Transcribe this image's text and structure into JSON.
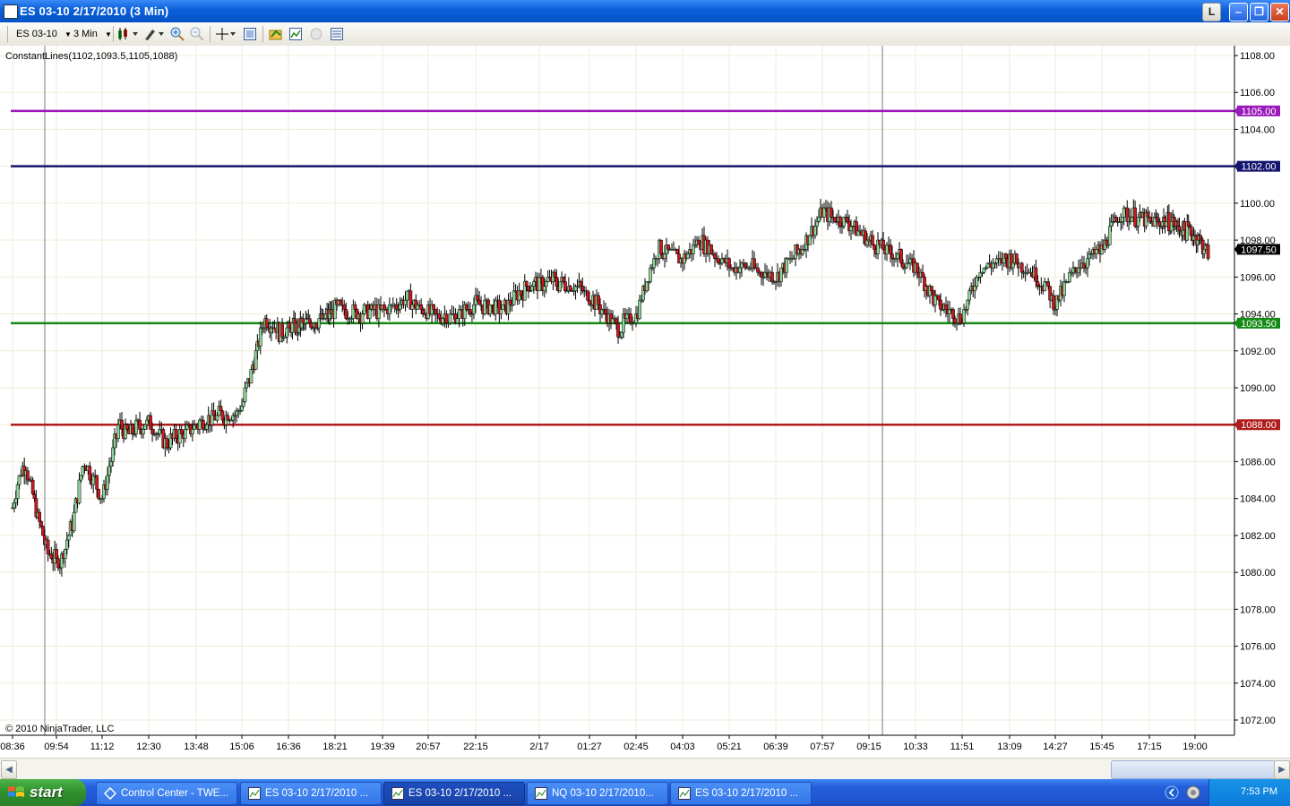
{
  "window": {
    "title": "ES 03-10  2/17/2010 (3 Min)",
    "l_button": "L"
  },
  "toolbar": {
    "instrument": "ES 03-10",
    "interval": "3 Min"
  },
  "chart": {
    "indicator_label": "ConstantLines(1102,1093.5,1105,1088)",
    "copyright": "© 2010 NinjaTrader, LLC",
    "colors": {
      "purple": "#9a1aba",
      "navy": "#14146e",
      "green": "#138a13",
      "red": "#b01c1c",
      "up_candle": "#8fd49a",
      "down_candle": "#cc1a22"
    }
  },
  "chart_data": {
    "type": "candlestick",
    "instrument": "ES 03-10",
    "interval": "3 Min",
    "ylim": [
      1071,
      1109
    ],
    "y_ticks": [
      "1108.00",
      "1106.00",
      "1104.00",
      "1102.00",
      "1100.00",
      "1098.00",
      "1096.00",
      "1094.00",
      "1092.00",
      "1090.00",
      "1088.00",
      "1086.00",
      "1084.00",
      "1082.00",
      "1080.00",
      "1078.00",
      "1076.00",
      "1074.00",
      "1072.00"
    ],
    "x_ticks": [
      "08:36",
      "09:54",
      "11:12",
      "12:30",
      "13:48",
      "15:06",
      "16:36",
      "18:21",
      "19:39",
      "20:57",
      "22:15",
      "2/17",
      "01:27",
      "02:45",
      "04:03",
      "05:21",
      "06:39",
      "07:57",
      "09:15",
      "10:33",
      "11:51",
      "13:09",
      "14:27",
      "15:45",
      "17:15",
      "19:00"
    ],
    "constant_lines": [
      {
        "value": 1105.0,
        "label": "1105.00",
        "color": "#9a1aba"
      },
      {
        "value": 1102.0,
        "label": "1102.00",
        "color": "#14146e"
      },
      {
        "value": 1093.5,
        "label": "1093.50",
        "color": "#138a13"
      },
      {
        "value": 1088.0,
        "label": "1088.00",
        "color": "#b01c1c"
      }
    ],
    "last_price": "1097.50",
    "session_breaks": [
      "09:54",
      "09:15"
    ],
    "path_keypoints": [
      [
        "08:36",
        1083.5
      ],
      [
        "08:50",
        1085.5
      ],
      [
        "09:00",
        1085.8
      ],
      [
        "09:20",
        1083.0
      ],
      [
        "09:40",
        1081.0
      ],
      [
        "10:00",
        1080.5
      ],
      [
        "10:20",
        1082.5
      ],
      [
        "10:40",
        1086.0
      ],
      [
        "11:00",
        1085.0
      ],
      [
        "11:12",
        1084.0
      ],
      [
        "11:40",
        1088.0
      ],
      [
        "11:55",
        1087.5
      ],
      [
        "12:30",
        1088.2
      ],
      [
        "13:00",
        1087.0
      ],
      [
        "13:48",
        1088.0
      ],
      [
        "14:20",
        1088.5
      ],
      [
        "14:50",
        1088.5
      ],
      [
        "15:06",
        1089.0
      ],
      [
        "15:30",
        1091.5
      ],
      [
        "15:50",
        1093.8
      ],
      [
        "16:20",
        1093.0
      ],
      [
        "16:36",
        1093.2
      ],
      [
        "17:20",
        1093.5
      ],
      [
        "18:00",
        1093.8
      ],
      [
        "18:21",
        1094.3
      ],
      [
        "19:00",
        1094.0
      ],
      [
        "19:39",
        1094.2
      ],
      [
        "20:20",
        1094.8
      ],
      [
        "20:57",
        1094.0
      ],
      [
        "21:40",
        1093.8
      ],
      [
        "22:15",
        1094.5
      ],
      [
        "23:00",
        1094.3
      ],
      [
        "23:40",
        1095.5
      ],
      [
        "00:20",
        1095.8
      ],
      [
        "01:00",
        1095.5
      ],
      [
        "01:27",
        1095.0
      ],
      [
        "02:15",
        1093.2
      ],
      [
        "02:45",
        1094.0
      ],
      [
        "03:20",
        1097.5
      ],
      [
        "04:03",
        1097.0
      ],
      [
        "04:30",
        1098.0
      ],
      [
        "05:00",
        1097.2
      ],
      [
        "05:21",
        1096.5
      ],
      [
        "06:00",
        1096.5
      ],
      [
        "06:39",
        1096.0
      ],
      [
        "07:20",
        1097.5
      ],
      [
        "07:57",
        1099.5
      ],
      [
        "08:40",
        1099.0
      ],
      [
        "09:15",
        1098.0
      ],
      [
        "09:40",
        1097.5
      ],
      [
        "10:33",
        1096.5
      ],
      [
        "11:10",
        1094.5
      ],
      [
        "11:51",
        1093.8
      ],
      [
        "12:20",
        1096.5
      ],
      [
        "13:09",
        1097.0
      ],
      [
        "13:40",
        1096.5
      ],
      [
        "14:10",
        1095.5
      ],
      [
        "14:27",
        1094.5
      ],
      [
        "15:00",
        1096.5
      ],
      [
        "15:45",
        1097.5
      ],
      [
        "16:20",
        1099.5
      ],
      [
        "17:15",
        1099.0
      ],
      [
        "18:00",
        1099.0
      ],
      [
        "19:00",
        1098.3
      ],
      [
        "19:30",
        1097.3
      ]
    ]
  },
  "taskbar": {
    "start_label": "start",
    "tasks": [
      {
        "label": "Control Center - TWE..."
      },
      {
        "label": "ES 03-10  2/17/2010 ..."
      },
      {
        "label": "ES 03-10  2/17/2010 ..."
      },
      {
        "label": "NQ 03-10  2/17/2010..."
      },
      {
        "label": "ES 03-10  2/17/2010 ..."
      }
    ],
    "clock": "7:53 PM"
  }
}
